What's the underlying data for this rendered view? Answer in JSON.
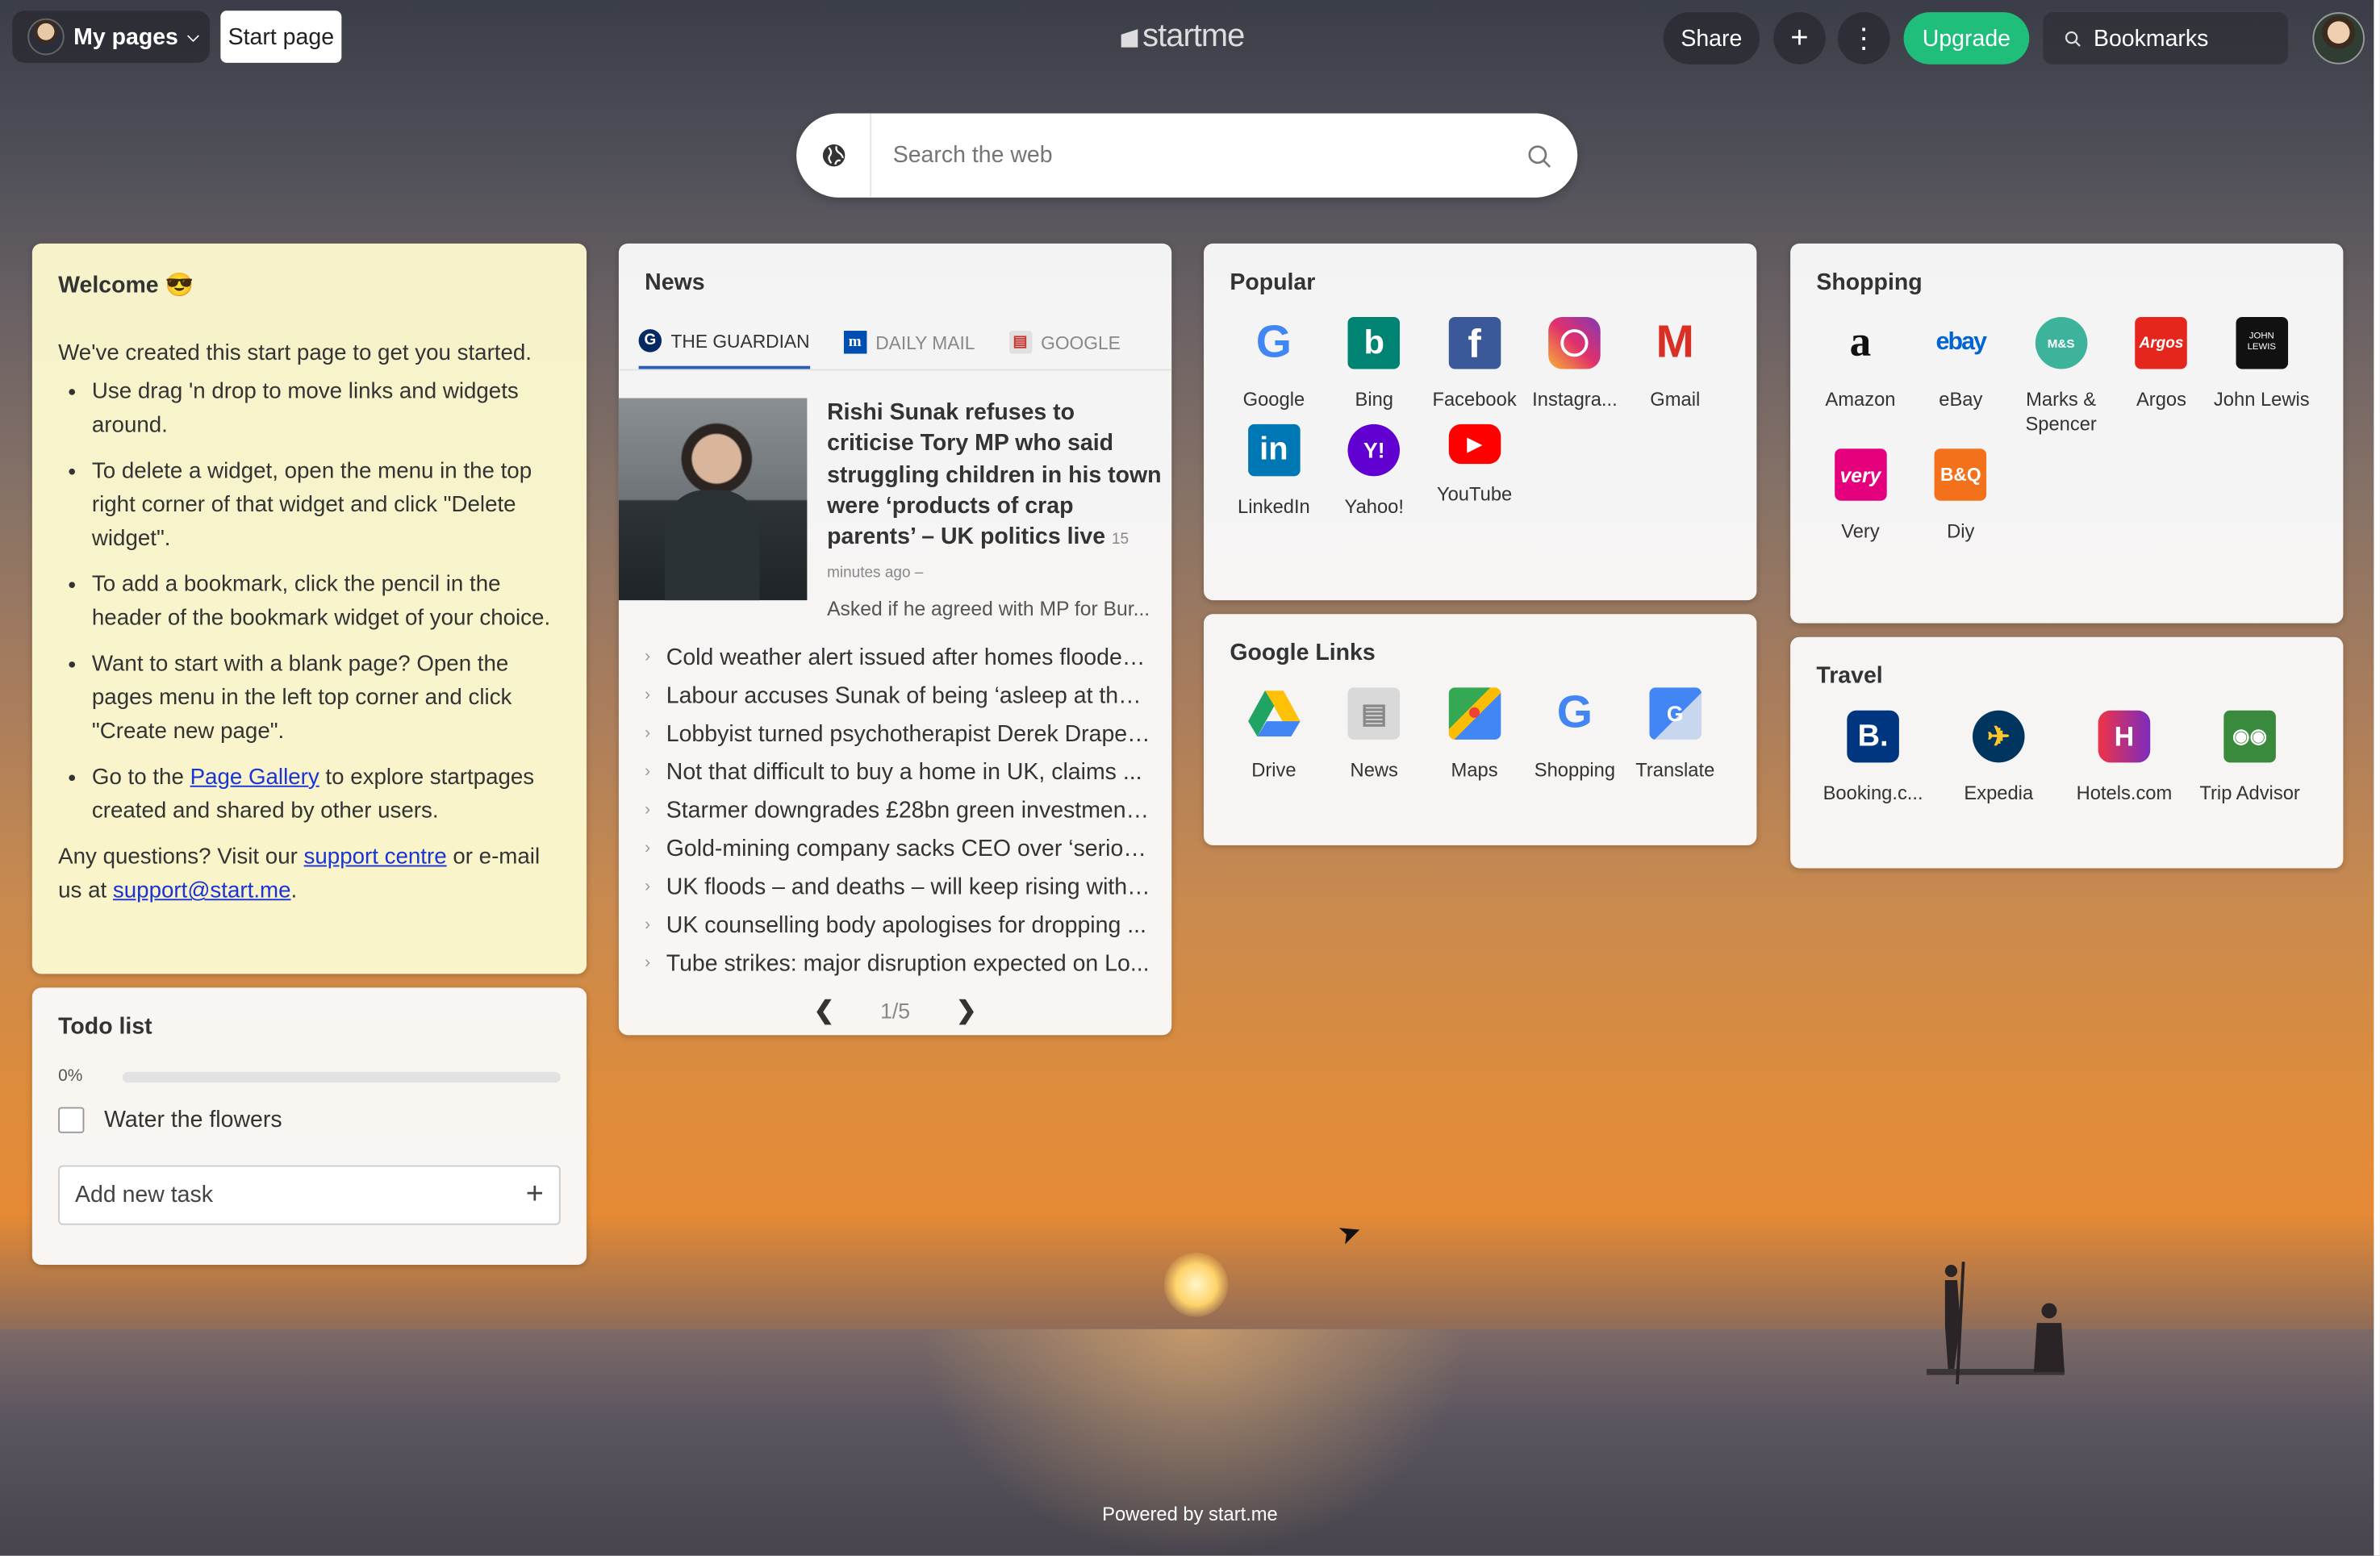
{
  "topbar": {
    "my_pages": "My pages",
    "start_page": "Start page",
    "logo": "startme",
    "share": "Share",
    "upgrade": "Upgrade",
    "bookmarks_placeholder": "Bookmarks"
  },
  "search": {
    "placeholder": "Search the web"
  },
  "welcome": {
    "title": "Welcome 😎",
    "intro": "We've created this start page to get you started.",
    "bullets": [
      "Use drag 'n drop to move links and widgets around.",
      "To delete a widget, open the menu in the top right corner of that widget and click \"Delete widget\".",
      "To add a bookmark, click the pencil in the header of the bookmark widget of your choice.",
      "Want to start with a blank page? Open the pages menu in the left top corner and click \"Create new page\"."
    ],
    "gallery_pre": "Go to the ",
    "gallery_link": "Page Gallery",
    "gallery_post": " to explore startpages created and shared by other users.",
    "questions_pre": "Any questions? Visit our ",
    "support_link": "support centre",
    "questions_mid": " or e-mail us at ",
    "email": "support@start.me",
    "questions_end": "."
  },
  "todo": {
    "title": "Todo list",
    "progress_label": "0%",
    "progress": 0,
    "tasks": [
      "Water the flowers"
    ],
    "add_placeholder": "Add new task"
  },
  "news": {
    "title": "News",
    "tabs": [
      "THE GUARDIAN",
      "DAILY MAIL",
      "GOOGLE"
    ],
    "featured": {
      "title": "Rishi Sunak refuses to criticise Tory MP who said struggling children in his town were ‘products of crap parents’ – UK politics live",
      "time": "15 minutes ago –",
      "desc": "Asked if he agreed with MP for Bur..."
    },
    "items": [
      "Cold weather alert issued after homes flooded...",
      "Labour accuses Sunak of being ‘asleep at the ...",
      "Lobbyist turned psychotherapist Derek Draper...",
      "Not that difficult to buy a home in UK, claims ...",
      "Starmer downgrades £28bn green investment ...",
      "Gold-mining company sacks CEO over ‘serious...",
      "UK floods – and deaths – will keep rising witho...",
      "UK counselling body apologises for dropping ...",
      "Tube strikes: major disruption expected on Lo..."
    ],
    "pager": "1/5"
  },
  "popular": {
    "title": "Popular",
    "items": [
      "Google",
      "Bing",
      "Facebook",
      "Instagra...",
      "Gmail",
      "LinkedIn",
      "Yahoo!",
      "YouTube"
    ]
  },
  "google_links": {
    "title": "Google Links",
    "items": [
      "Drive",
      "News",
      "Maps",
      "Shopping",
      "Translate"
    ]
  },
  "shopping": {
    "title": "Shopping",
    "items": [
      "Amazon",
      "eBay",
      "Marks & Spencer",
      "Argos",
      "John Lewis",
      "Very",
      "Diy"
    ]
  },
  "travel": {
    "title": "Travel",
    "items": [
      "Booking.c...",
      "Expedia",
      "Hotels.com",
      "Trip Advisor"
    ]
  },
  "footer": {
    "powered": "Powered by start.me"
  },
  "colors": {
    "upgrade": "#1fbf7b",
    "link": "#1a33d6",
    "welcome_bg": "#fbf8ce"
  }
}
